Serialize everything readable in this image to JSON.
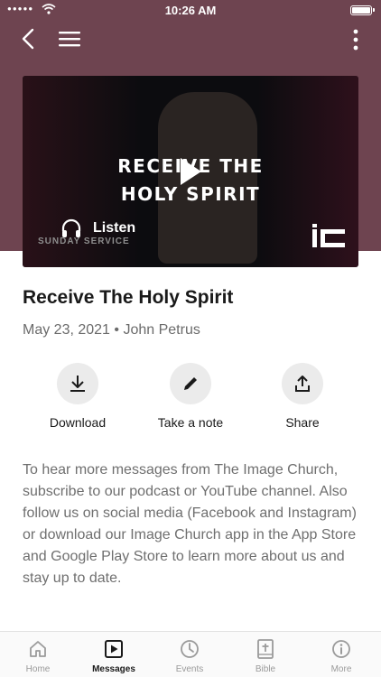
{
  "status": {
    "time": "10:26 AM",
    "signal": "●●●●●"
  },
  "icons": {
    "back": "chevron-left-icon",
    "menu": "hamburger-icon",
    "more": "vertical-dots-icon",
    "play": "play-icon",
    "listen": "headphones-icon",
    "download": "download-icon",
    "note": "pencil-icon",
    "share": "share-icon"
  },
  "colors": {
    "header": "#6e4450",
    "muted": "#6f6f6f",
    "action_bg": "#ebebeb"
  },
  "video": {
    "overlay_line1": "RECEIVE THE",
    "overlay_line2": "HOLY SPIRIT",
    "series_label": "SUNDAY SERVICE",
    "listen_label": "Listen",
    "logo_text": "IC"
  },
  "message": {
    "title": "Receive The Holy Spirit",
    "date": "May 23, 2021",
    "separator": "•",
    "speaker": "John Petrus"
  },
  "actions": [
    {
      "label": "Download"
    },
    {
      "label": "Take a note"
    },
    {
      "label": "Share"
    }
  ],
  "description": "To hear more messages from The Image Church, subscribe to our podcast or YouTube channel. Also follow us on social media (Facebook and Instagram) or download our Image Church app in the App Store and Google Play Store to learn more about us and stay up to date.",
  "tabs": [
    {
      "label": "Home",
      "icon": "home-icon",
      "active": false
    },
    {
      "label": "Messages",
      "icon": "play-square-icon",
      "active": true
    },
    {
      "label": "Events",
      "icon": "clock-icon",
      "active": false
    },
    {
      "label": "Bible",
      "icon": "bible-icon",
      "active": false
    },
    {
      "label": "More",
      "icon": "info-icon",
      "active": false
    }
  ]
}
